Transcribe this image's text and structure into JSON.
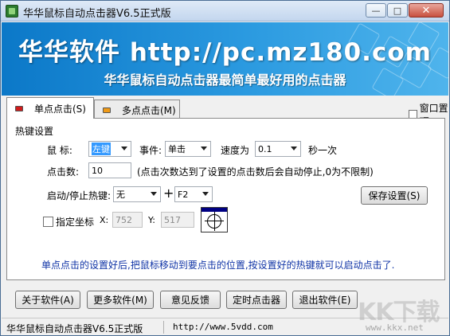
{
  "window": {
    "title": "华华鼠标自动点击器V6.5正式版",
    "min_glyph": "—",
    "max_glyph": "□",
    "close_glyph": "✕"
  },
  "banner": {
    "title": "华华软件 http://pc.mz180.com",
    "subtitle": "华华鼠标自动点击器最简单最好用的点击器"
  },
  "tabs": [
    {
      "label": "单点点击(S)",
      "active": true,
      "led_color": "#d01c1c"
    },
    {
      "label": "多点点击(M)",
      "active": false,
      "led_color": "#f09a16"
    }
  ],
  "topmost_label": "窗口置顶",
  "hotkey_group": {
    "label": "热键设置",
    "mouse_label": "鼠  标:",
    "mouse_value": "左键",
    "event_label": "事件:",
    "event_value": "单击",
    "speed_label": "速度为",
    "speed_value": "0.1",
    "speed_unit": "秒一次",
    "click_count_label": "点击数:",
    "click_count_value": "10",
    "click_count_note": "(点击次数达到了设置的点击数后会自动停止,0为不限制)",
    "hotkey_label": "启动/停止热键:",
    "hotkey_modifier": "无",
    "plus_sign": "+",
    "hotkey_key": "F2",
    "save_button": "保存设置(S)",
    "specify_coord_label": "指定坐标",
    "x_label": "X:",
    "x_value": "752",
    "y_label": "Y:",
    "y_value": "517",
    "hint": "单点点击的设置好后,把鼠标移动到要点击的位置,按设置好的热键就可以启动点击了."
  },
  "bottom_buttons": [
    {
      "label": "关于软件(A)"
    },
    {
      "label": "更多软件(M)"
    },
    {
      "label": "意见反馈"
    },
    {
      "label": "定时点击器"
    },
    {
      "label": "退出软件(E)"
    }
  ],
  "statusbar": {
    "left": "华华鼠标自动点击器V6.5正式版",
    "url": "http://www.5vdd.com"
  },
  "watermark": {
    "text": "KK下载",
    "url": "www.kkx.net"
  }
}
